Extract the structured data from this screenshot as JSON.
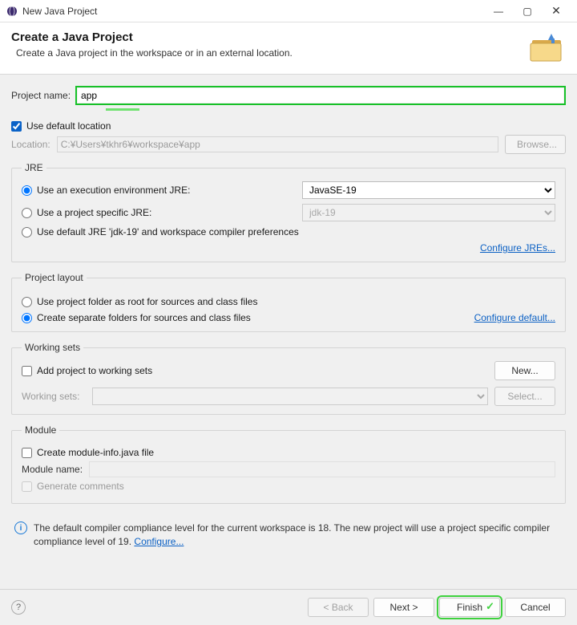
{
  "titlebar": {
    "title": "New Java Project"
  },
  "banner": {
    "heading": "Create a Java Project",
    "subheading": "Create a Java project in the workspace or in an external location."
  },
  "projectName": {
    "label": "Project name:",
    "value": "app"
  },
  "location": {
    "useDefaultLabel": "Use default location",
    "locationLabel": "Location:",
    "path": "C:¥Users¥tkhr6¥workspace¥app",
    "browse": "Browse..."
  },
  "jre": {
    "legend": "JRE",
    "opt1": "Use an execution environment JRE:",
    "opt1_value": "JavaSE-19",
    "opt2": "Use a project specific JRE:",
    "opt2_value": "jdk-19",
    "opt3": "Use default JRE 'jdk-19' and workspace compiler preferences",
    "configure": "Configure JREs..."
  },
  "layout": {
    "legend": "Project layout",
    "opt1": "Use project folder as root for sources and class files",
    "opt2": "Create separate folders for sources and class files",
    "configure": "Configure default..."
  },
  "workingSets": {
    "legend": "Working sets",
    "addLabel": "Add project to working sets",
    "new": "New...",
    "wsLabel": "Working sets:",
    "select": "Select..."
  },
  "module": {
    "legend": "Module",
    "createLabel": "Create module-info.java file",
    "moduleNameLabel": "Module name:",
    "generateComments": "Generate comments"
  },
  "info": {
    "text1": "The default compiler compliance level for the current workspace is 18. The new project will use a project specific compiler compliance level of 19. ",
    "configure": "Configure..."
  },
  "buttons": {
    "back": "< Back",
    "next": "Next >",
    "finish": "Finish",
    "cancel": "Cancel"
  }
}
